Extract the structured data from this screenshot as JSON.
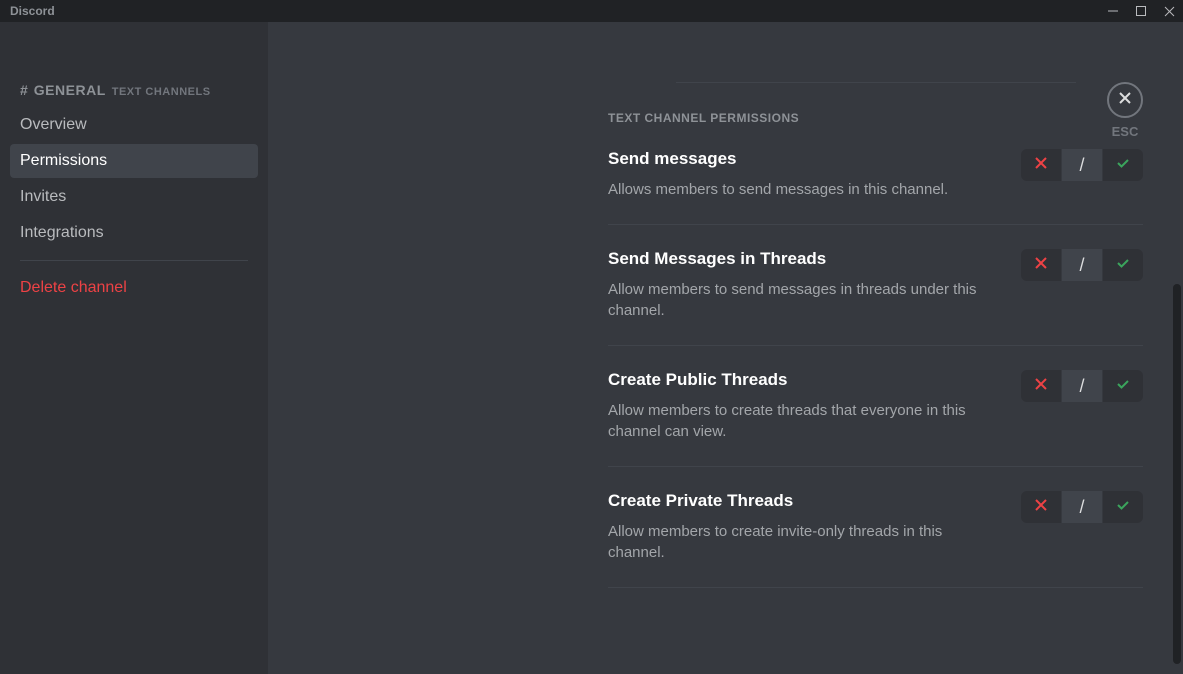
{
  "titlebar": {
    "title": "Discord"
  },
  "sidebar": {
    "hash": "#",
    "channel_name": "GENERAL",
    "channel_type": "TEXT CHANNELS",
    "items": [
      {
        "label": "Overview",
        "active": false
      },
      {
        "label": "Permissions",
        "active": true
      },
      {
        "label": "Invites",
        "active": false
      },
      {
        "label": "Integrations",
        "active": false
      }
    ],
    "delete_label": "Delete channel"
  },
  "close": {
    "esc": "ESC"
  },
  "section_header": "TEXT CHANNEL PERMISSIONS",
  "perms": [
    {
      "title": "Send messages",
      "desc": "Allows members to send messages in this channel.",
      "state": "passthrough"
    },
    {
      "title": "Send Messages in Threads",
      "desc": "Allow members to send messages in threads under this channel.",
      "state": "passthrough"
    },
    {
      "title": "Create Public Threads",
      "desc": "Allow members to create threads that everyone in this channel can view.",
      "state": "passthrough"
    },
    {
      "title": "Create Private Threads",
      "desc": "Allow members to create invite-only threads in this channel.",
      "state": "passthrough"
    }
  ],
  "toggle": {
    "passthrough_glyph": "/"
  }
}
